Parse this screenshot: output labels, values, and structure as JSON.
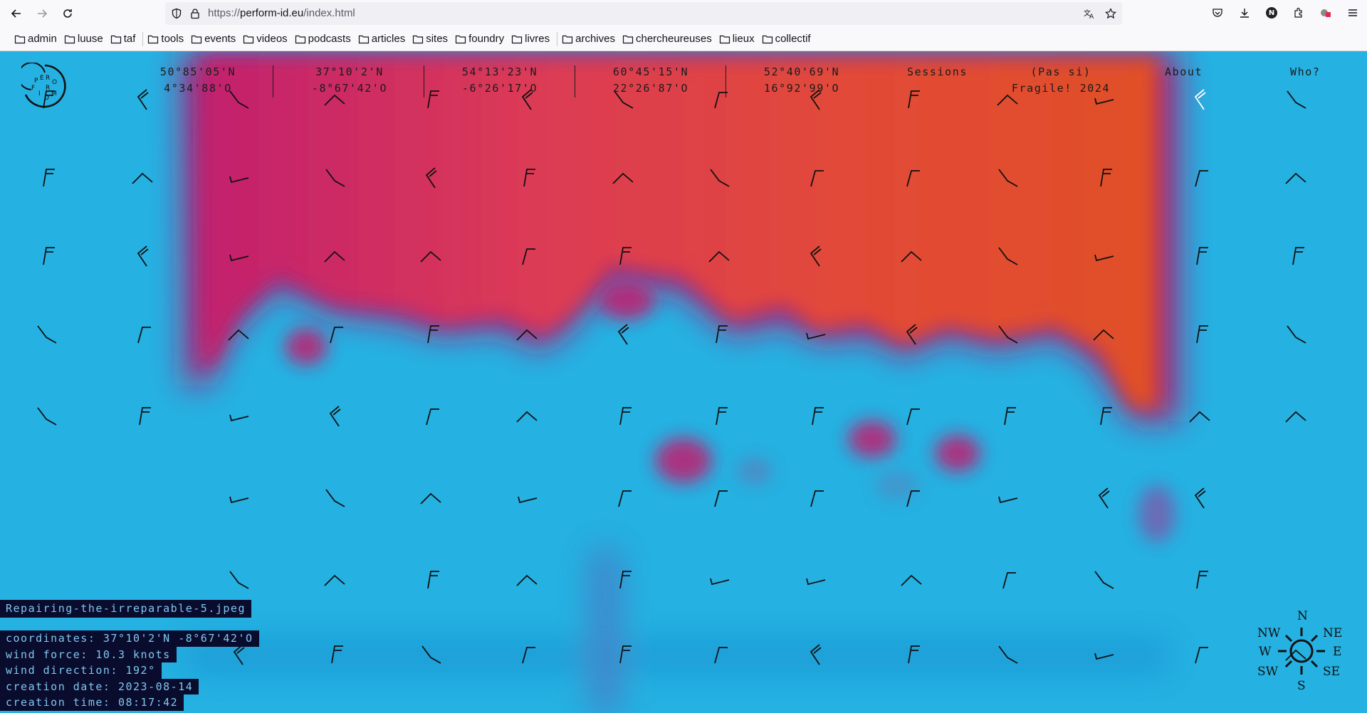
{
  "browser": {
    "url_scheme": "https://",
    "url_host": "perform-id.eu",
    "url_path": "/index.html",
    "profile_initial": "N",
    "bookmarks": [
      "admin",
      "luuse",
      "taf",
      "tools",
      "events",
      "videos",
      "podcasts",
      "articles",
      "sites",
      "foundry",
      "livres",
      "archives",
      "chercheureuses",
      "lieux",
      "collectif"
    ]
  },
  "page": {
    "logo_letters": [
      "P",
      "E",
      "R",
      "F",
      "O",
      "R",
      "M",
      "I",
      "D"
    ],
    "nav": {
      "coords": [
        {
          "lat": "50°85'05'N",
          "lon": "4°34'88'O"
        },
        {
          "lat": "37°10'2'N",
          "lon": "-8°67'42'O"
        },
        {
          "lat": "54°13'23'N",
          "lon": "-6°26'17'O"
        },
        {
          "lat": "60°45'15'N",
          "lon": "22°26'87'O"
        },
        {
          "lat": "52°40'69'N",
          "lon": "16°92'99'O"
        }
      ],
      "sessions": "Sessions",
      "pas_si_1": "(Pas si)",
      "pas_si_2": "Fragile! 2024",
      "about": "About",
      "who": "Who?"
    },
    "info": {
      "filename": "Repairing-the-irreparable-5.jpeg",
      "coordinates": "coordinates: 37°10'2'N -8°67'42'O",
      "wind_force": "wind force: 10.3 knots",
      "wind_direction": "wind direction: 192°",
      "creation_date": "creation date: 2023-08-14",
      "creation_time": "creation time: 08:17:42"
    },
    "compass": {
      "n": "N",
      "ne": "NE",
      "e": "E",
      "se": "SE",
      "s": "S",
      "sw": "SW",
      "w": "W",
      "nw": "NW"
    },
    "colors": {
      "sky": "#25b1e2",
      "heat_orange": "#e2552d",
      "heat_magenta": "#c61f6b",
      "ink": "#1b1b1b",
      "panel": "#0a0c2e",
      "panel_text": "#7fc8ef"
    }
  }
}
